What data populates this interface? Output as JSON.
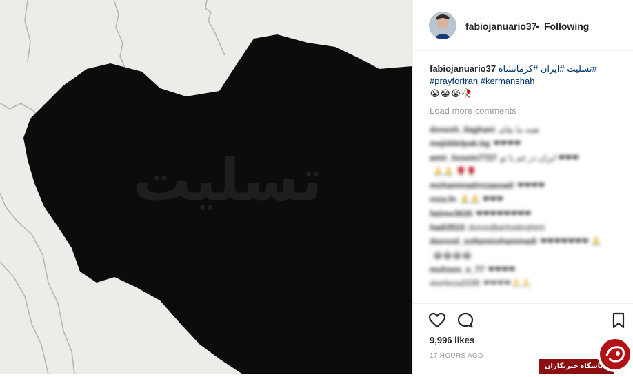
{
  "post": {
    "image_alt": "Black silhouette map of Iran",
    "image_overlay_text": "تسلیت"
  },
  "header": {
    "username": "fabiojanuario37",
    "separator": "•",
    "follow_status": "Following"
  },
  "caption": {
    "username": "fabiojanuario37",
    "tags_line1": [
      "#تسلیت",
      "#ایران",
      "#کرمانشاه"
    ],
    "tags_line2": [
      "#prayforIran",
      "#kermanshah"
    ],
    "emoji_line": "😭😭😭🥀"
  },
  "comments": {
    "load_more": "Load more comments",
    "items": [
      {
        "user": "donesh_ilaghani",
        "text": "همه ما بقای"
      },
      {
        "user": "majiddelpak.bg",
        "text": "❤❤❤❤"
      },
      {
        "user": "amir_hosein7727",
        "text": "ایران در غم با تو  ❤❤❤"
      },
      {
        "user": "",
        "text": "🙏🙏 🌹🌹"
      },
      {
        "user": "mohammadrezaasadi",
        "text": "❤❤❤❤"
      },
      {
        "user": "reza.fn",
        "text": "🙏🙏 ❤❤❤"
      },
      {
        "user": "fatime3635",
        "text": "❤❤❤❤❤❤❤❤"
      },
      {
        "user": "hadi3515",
        "text": "doroodbartoebrahimi"
      },
      {
        "user": "davood_soltanmohammadi",
        "text": "❤❤❤❤❤❤❤ 🙏"
      },
      {
        "user": "",
        "text": "😭😭😭😭"
      },
      {
        "user": "mohsen_s_77",
        "text": "❤❤❤❤"
      },
      {
        "user": "morteza2235",
        "text": "❤❤❤❤🙏🙏"
      }
    ]
  },
  "actions": {
    "like_icon": "heart-icon",
    "comment_icon": "comment-icon",
    "save_icon": "bookmark-icon",
    "likes_text": "9,996 likes",
    "timestamp": "17 HOURS AGO"
  },
  "watermark": {
    "text": "باشگاه خبرنگاران",
    "brand_color": "#8b0e10"
  }
}
